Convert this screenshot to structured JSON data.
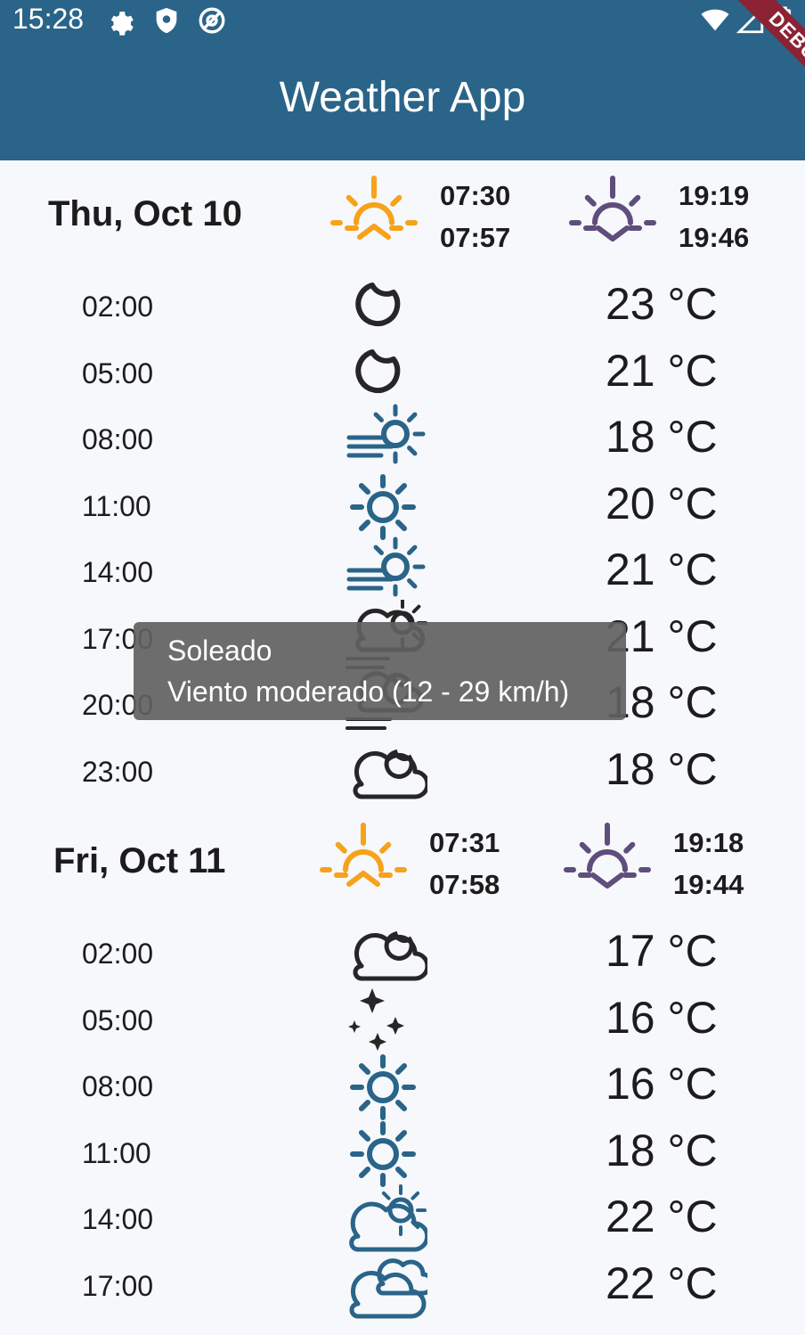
{
  "status_bar": {
    "time": "15:28",
    "icons": [
      "gear-icon",
      "shield-icon",
      "at-sign-icon",
      "wifi-icon",
      "signal-icon",
      "battery-charging-icon"
    ]
  },
  "app_bar": {
    "title": "Weather App",
    "debug_banner": "DEBUG"
  },
  "colors": {
    "app_bar": "#2a6489",
    "sunrise": "#f6a21a",
    "sunset": "#5f4e7d",
    "icon_dark": "#262626",
    "icon_blue": "#2a6489",
    "tooltip": "#616161"
  },
  "days": [
    {
      "label": "Thu, Oct 10",
      "sunrise_times": [
        "07:30",
        "07:57"
      ],
      "sunset_times": [
        "19:19",
        "19:46"
      ],
      "hours": [
        {
          "time": "02:00",
          "icon": "moon-icon",
          "temp": "23 °C"
        },
        {
          "time": "05:00",
          "icon": "moon-icon",
          "temp": "21 °C"
        },
        {
          "time": "08:00",
          "icon": "wind-sun-icon",
          "temp": "18 °C"
        },
        {
          "time": "11:00",
          "icon": "sun-icon",
          "temp": "20 °C"
        },
        {
          "time": "14:00",
          "icon": "wind-sun-icon",
          "temp": "21 °C"
        },
        {
          "time": "17:00",
          "icon": "wind-cloud-sun-icon",
          "temp": "21 °C"
        },
        {
          "time": "20:00",
          "icon": "wind-cloud-moon-icon",
          "temp": "18 °C"
        },
        {
          "time": "23:00",
          "icon": "cloud-moon-icon",
          "temp": "18 °C"
        }
      ]
    },
    {
      "label": "Fri, Oct 11",
      "sunrise_times": [
        "07:31",
        "07:58"
      ],
      "sunset_times": [
        "19:18",
        "19:44"
      ],
      "hours": [
        {
          "time": "02:00",
          "icon": "cloud-moon-icon",
          "temp": "17 °C"
        },
        {
          "time": "05:00",
          "icon": "stars-icon",
          "temp": "16 °C"
        },
        {
          "time": "08:00",
          "icon": "sun-icon",
          "temp": "16 °C"
        },
        {
          "time": "11:00",
          "icon": "sun-icon",
          "temp": "18 °C"
        },
        {
          "time": "14:00",
          "icon": "cloud-sun-icon",
          "temp": "22 °C"
        },
        {
          "time": "17:00",
          "icon": "clouds-icon",
          "temp": "22 °C"
        }
      ]
    }
  ],
  "tooltip": {
    "line1": "Soleado",
    "line2": "Viento moderado (12 - 29 km/h)"
  }
}
